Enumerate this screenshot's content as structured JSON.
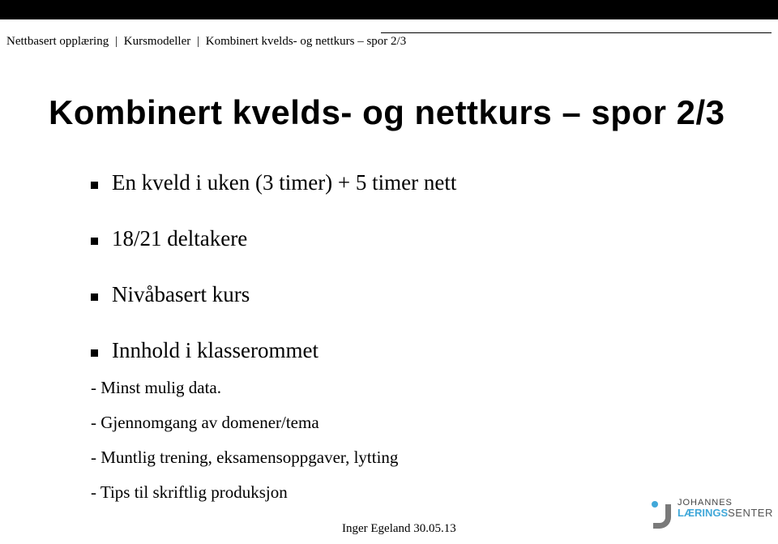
{
  "breadcrumb": {
    "seg1": "Nettbasert opplæring",
    "seg2": "Kursmodeller",
    "seg3": "Kombinert kvelds- og nettkurs – spor 2/3"
  },
  "title": "Kombinert kvelds- og nettkurs – spor 2/3",
  "bullets": {
    "b1": "En kveld i uken (3 timer) + 5 timer nett",
    "b2": "18/21 deltakere",
    "b3": "Nivåbasert kurs",
    "b4": "Innhold i klasserommet"
  },
  "subbullets": {
    "s1": "- Minst mulig data.",
    "s2": "- Gjennomgang av domener/tema",
    "s3": "- Muntlig trening, eksamensoppgaver, lytting",
    "s4": "- Tips til skriftlig produksjon"
  },
  "footer": {
    "author_date": "Inger Egeland  30.05.13"
  },
  "logo": {
    "top": "JOHANNES",
    "accent": "LÆRINGS",
    "rest": "SENTER"
  }
}
